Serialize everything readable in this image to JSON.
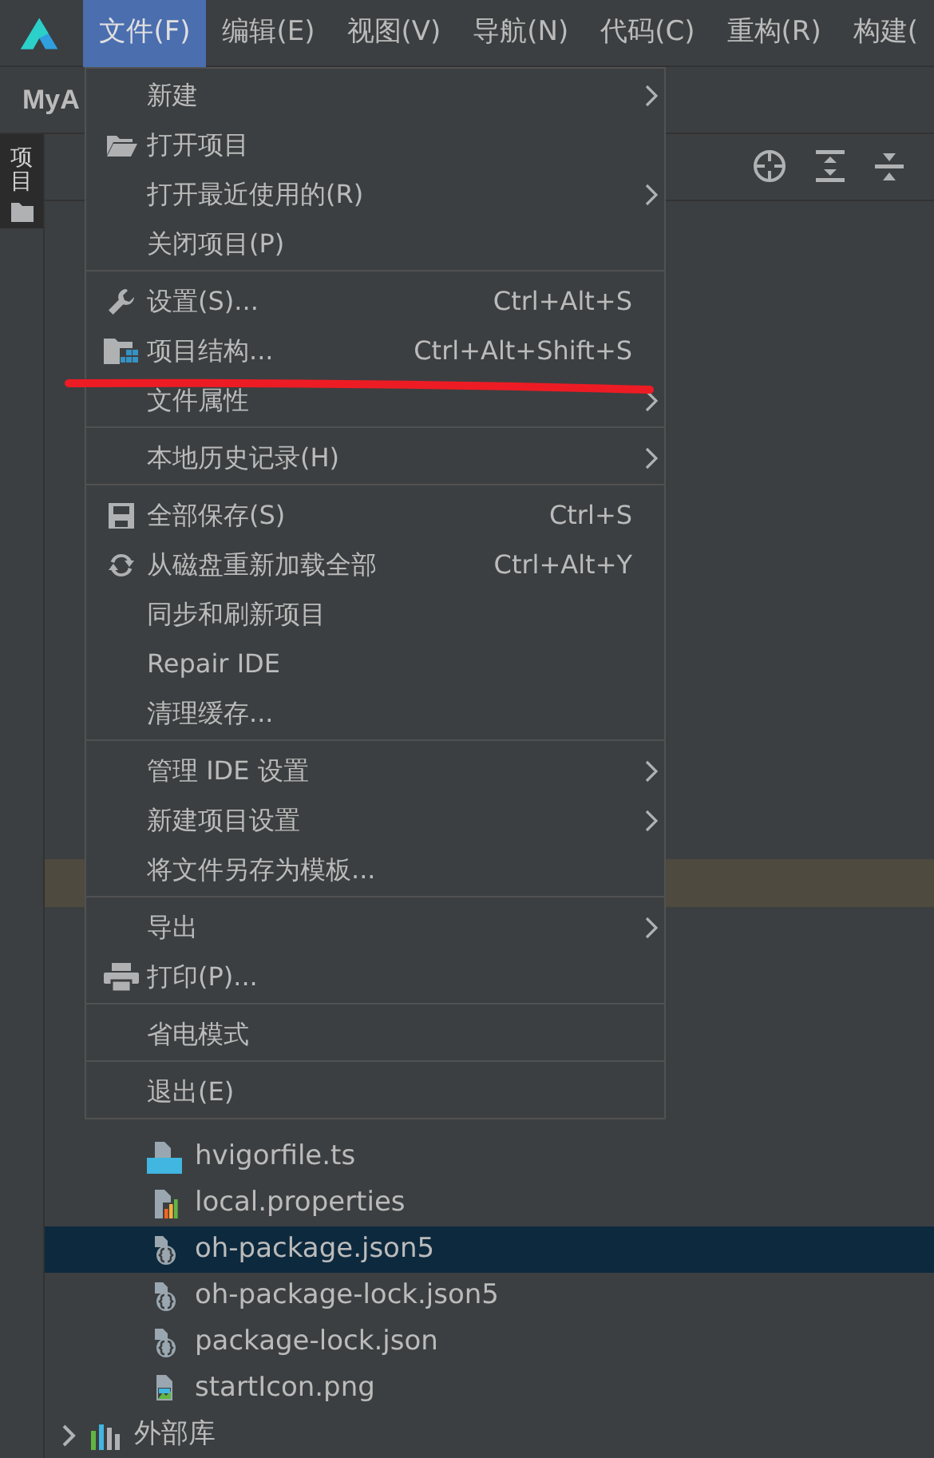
{
  "menu_bar": {
    "items": [
      {
        "label": "文件(F)",
        "selected": true
      },
      {
        "label": "编辑(E)",
        "selected": false
      },
      {
        "label": "视图(V)",
        "selected": false
      },
      {
        "label": "导航(N)",
        "selected": false
      },
      {
        "label": "代码(C)",
        "selected": false
      },
      {
        "label": "重构(R)",
        "selected": false
      },
      {
        "label": "构建(",
        "selected": false
      }
    ]
  },
  "project_bar": {
    "title": "MyA"
  },
  "tool_strip": {
    "tabs": [
      {
        "label": "项目",
        "selected": true
      }
    ]
  },
  "file_menu": {
    "items": [
      {
        "kind": "item",
        "label": "新建",
        "submenu": true
      },
      {
        "kind": "folder",
        "label": "打开项目",
        "submenu": false
      },
      {
        "kind": "item",
        "label": "打开最近使用的(R)",
        "submenu": true
      },
      {
        "kind": "item",
        "label": "关闭项目(P)",
        "submenu": false
      },
      {
        "kind": "separator"
      },
      {
        "kind": "wrench",
        "label": "设置(S)...",
        "shortcut": "Ctrl+Alt+S",
        "submenu": false
      },
      {
        "kind": "structure",
        "label": "项目结构...",
        "shortcut": "Ctrl+Alt+Shift+S",
        "submenu": false
      },
      {
        "kind": "item",
        "label": "文件属性",
        "submenu": true
      },
      {
        "kind": "separator"
      },
      {
        "kind": "item",
        "label": "本地历史记录(H)",
        "submenu": true
      },
      {
        "kind": "separator"
      },
      {
        "kind": "save",
        "label": "全部保存(S)",
        "shortcut": "Ctrl+S",
        "submenu": false
      },
      {
        "kind": "reload",
        "label": "从磁盘重新加载全部",
        "shortcut": "Ctrl+Alt+Y",
        "submenu": false
      },
      {
        "kind": "item",
        "label": "同步和刷新项目",
        "submenu": false
      },
      {
        "kind": "item",
        "label": "Repair IDE",
        "submenu": false
      },
      {
        "kind": "item",
        "label": "清理缓存...",
        "submenu": false
      },
      {
        "kind": "separator"
      },
      {
        "kind": "item",
        "label": "管理 IDE 设置",
        "submenu": true
      },
      {
        "kind": "item",
        "label": "新建项目设置",
        "submenu": true
      },
      {
        "kind": "item",
        "label": "将文件另存为模板...",
        "submenu": false
      },
      {
        "kind": "separator"
      },
      {
        "kind": "item",
        "label": "导出",
        "submenu": true
      },
      {
        "kind": "printer",
        "label": "打印(P)...",
        "submenu": false
      },
      {
        "kind": "separator"
      },
      {
        "kind": "item",
        "label": "省电模式",
        "submenu": false
      },
      {
        "kind": "separator"
      },
      {
        "kind": "item",
        "label": "退出(E)",
        "submenu": false
      }
    ]
  },
  "annotation": {
    "kind": "underline"
  },
  "tree": {
    "rows": [
      {
        "label": "hvigorfile.ts",
        "kind": "ts",
        "selected": false
      },
      {
        "label": "local.properties",
        "kind": "properties",
        "selected": false
      },
      {
        "label": "oh-package.json5",
        "kind": "json",
        "selected": true
      },
      {
        "label": "oh-package-lock.json5",
        "kind": "json",
        "selected": false
      },
      {
        "label": "package-lock.json",
        "kind": "json",
        "selected": false
      },
      {
        "label": "startIcon.png",
        "kind": "image",
        "selected": false
      }
    ],
    "footer": {
      "label": "外部库"
    }
  }
}
